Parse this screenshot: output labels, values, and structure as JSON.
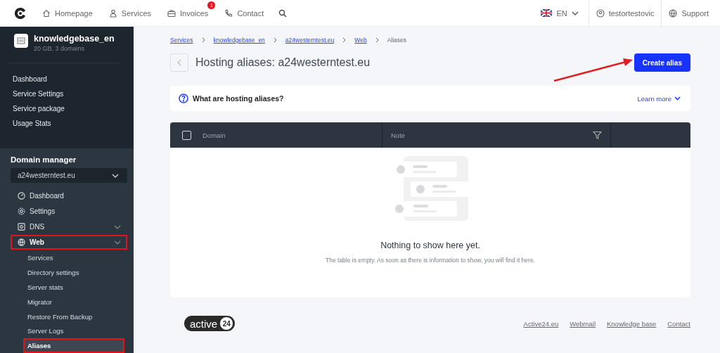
{
  "topbar": {
    "nav": [
      {
        "label": "Homepage"
      },
      {
        "label": "Services"
      },
      {
        "label": "Invoices",
        "badge": "1"
      },
      {
        "label": "Contact"
      }
    ],
    "language": "EN",
    "user": "testortestovic",
    "support": "Support"
  },
  "sidebar": {
    "service": {
      "name": "knowledgebase_en",
      "details": "20 GB, 3 domains"
    },
    "service_menu": [
      "Dashboard",
      "Service Settings",
      "Service package",
      "Usage Stats"
    ],
    "domain_manager": {
      "title": "Domain manager",
      "selected_domain": "a24westerntest.eu",
      "items": [
        {
          "label": "Dashboard",
          "expandable": false,
          "expanded": false,
          "highlighted": false
        },
        {
          "label": "Settings",
          "expandable": false,
          "expanded": false,
          "highlighted": false
        },
        {
          "label": "DNS",
          "expandable": true,
          "expanded": false,
          "highlighted": false
        },
        {
          "label": "Web",
          "expandable": true,
          "expanded": true,
          "highlighted": true,
          "children": [
            {
              "label": "Services",
              "selected": false,
              "highlighted": false
            },
            {
              "label": "Directory settings",
              "selected": false,
              "highlighted": false
            },
            {
              "label": "Server stats",
              "selected": false,
              "highlighted": false
            },
            {
              "label": "Migrator",
              "selected": false,
              "highlighted": false
            },
            {
              "label": "Restore From Backup",
              "selected": false,
              "highlighted": false
            },
            {
              "label": "Server Logs",
              "selected": false,
              "highlighted": false
            },
            {
              "label": "Aliases",
              "selected": true,
              "highlighted": true
            }
          ]
        }
      ]
    }
  },
  "main": {
    "breadcrumbs": [
      {
        "label": "Services",
        "link": true
      },
      {
        "label": "knowledgebase_en",
        "link": true
      },
      {
        "label": "a24westerntest.eu",
        "link": true
      },
      {
        "label": "Web",
        "link": true
      },
      {
        "label": "Aliases",
        "link": false
      }
    ],
    "title": "Hosting aliases: a24westerntest.eu",
    "create_button": "Create alias",
    "info": {
      "question": "What are hosting aliases?",
      "learn_more": "Learn more"
    },
    "table": {
      "select_all": false,
      "columns": [
        "Domain",
        "Note"
      ],
      "empty_title": "Nothing to show here yet.",
      "empty_text": "The table is empty. As soon as there is information to show, you will find it here."
    }
  },
  "footer": {
    "logo": [
      "active",
      "24"
    ],
    "links": [
      "Active24.eu",
      "Webmail",
      "Knowledge base",
      "Contact"
    ]
  }
}
